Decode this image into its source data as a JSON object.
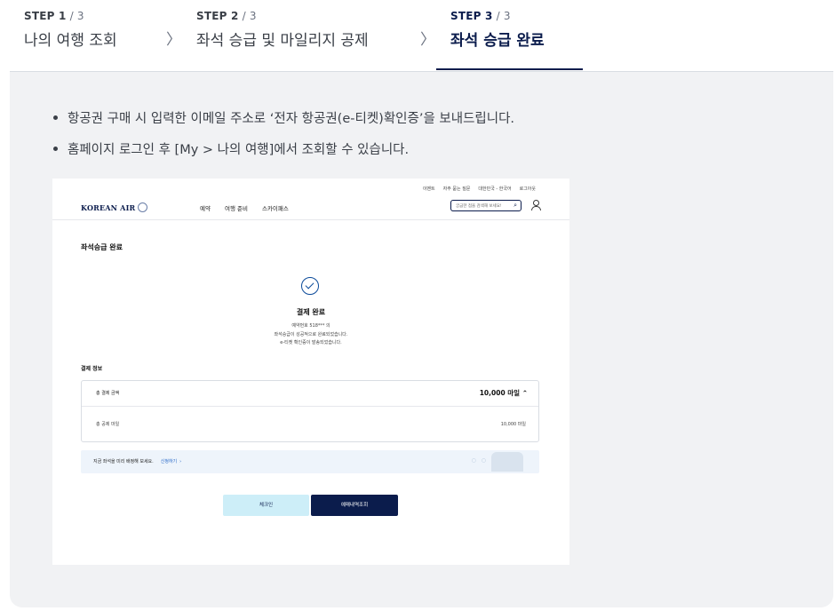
{
  "steps": [
    {
      "num": "STEP 1",
      "total": " / 3",
      "title": "나의 여행 조회"
    },
    {
      "num": "STEP 2",
      "total": " / 3",
      "title": "좌석 승급 및 마일리지 공제"
    },
    {
      "num": "STEP 3",
      "total": " / 3",
      "title": "좌석 승급 완료"
    }
  ],
  "chevron": "〉",
  "bullets": [
    "항공권 구매 시 입력한 이메일 주소로 ‘전자 항공권(e-티켓)확인증’을 보내드립니다.",
    "홈페이지 로그인 후 [My > 나의 여행]에서 조회할 수 있습니다."
  ],
  "screenshot": {
    "util": [
      "이벤트",
      "자주 묻는 질문",
      "대한민국 - 한국어",
      "로그아웃"
    ],
    "logo": "KOREAN AIR",
    "menu": [
      "예약",
      "여행 준비",
      "스카이패스"
    ],
    "search_placeholder": "궁금한 점을 검색해 보세요!",
    "page_title": "좌석승급 완료",
    "done_title": "결제 완료",
    "done_lines": [
      "예약번호 518*** 의",
      "좌석승급이 성공적으로 완료되었습니다.",
      "e-티켓 확인증이 발송되었습니다."
    ],
    "pay_label": "결제 정보",
    "total_label": "총 결제 금액",
    "total_value": "10,000 마일",
    "deduct_label": "총 공제 마일",
    "deduct_value": "10,000 마일",
    "banner_text": "지금 좌석을 미리 배정해 보세요.",
    "banner_link": "신청하기",
    "checkin_button": "체크인",
    "reservation_button": "예매내역조회"
  },
  "colors": {
    "accent": "#0b1c4c",
    "panel": "#f1f2f4",
    "link": "#1f63c6"
  }
}
